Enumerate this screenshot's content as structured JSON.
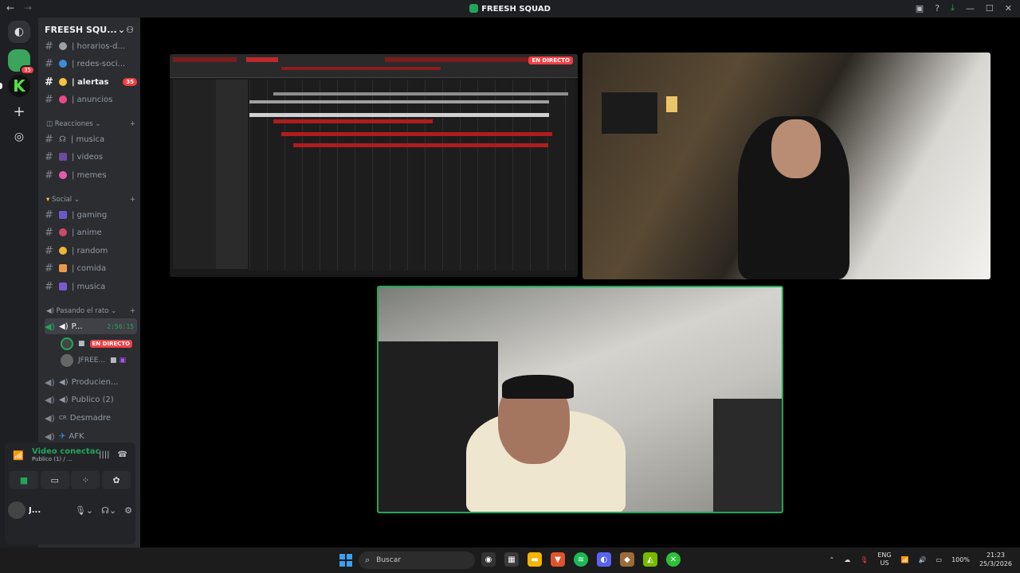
{
  "window": {
    "title": "FREESH SQUAD",
    "nav_back": "←",
    "nav_forward": "→"
  },
  "guilds": {
    "badge": "35"
  },
  "server": {
    "name": "FREESH SQU...",
    "text_channels": [
      {
        "name": "| horarios-d...",
        "emoji_color": "#9aa0a6"
      },
      {
        "name": "| redes-soci...",
        "emoji_color": "#3a8dde"
      },
      {
        "name": "| alertas",
        "emoji_color": "#f5c542",
        "count": "35"
      },
      {
        "name": "| anuncios",
        "emoji_color": "#e84a8a"
      }
    ],
    "categories": {
      "reacciones": "Reacciones",
      "social": "Social",
      "pasando": "Pasando el rato"
    },
    "reacciones_channels": [
      {
        "name": "| musica",
        "icon": "headphones-icon"
      },
      {
        "name": "| videos",
        "icon": "video-icon"
      },
      {
        "name": "| memes",
        "icon": "emoji-icon"
      }
    ],
    "social_channels": [
      {
        "name": "| gaming"
      },
      {
        "name": "| anime"
      },
      {
        "name": "| random"
      },
      {
        "name": "| comida"
      },
      {
        "name": "| musica"
      }
    ],
    "voice_channels": {
      "active_name": "P...",
      "active_timer": "2:56:15",
      "member_live": "EN DIRECTO",
      "member2": "JFREE...",
      "others": [
        "Producien...",
        "Publico (2)",
        "Desmadre",
        "AFK"
      ],
      "desmadre_prefix": "CR"
    }
  },
  "voice_panel": {
    "status": "Video conectac",
    "sub": "Publico (1) / ...",
    "user": "J..."
  },
  "stage": {
    "live_tag": "EN DIRECTO"
  },
  "taskbar": {
    "search_placeholder": "Buscar",
    "lang1": "ENG",
    "lang2": "US",
    "battery": "100%",
    "time": "21:23",
    "date": "25/3/2026"
  }
}
